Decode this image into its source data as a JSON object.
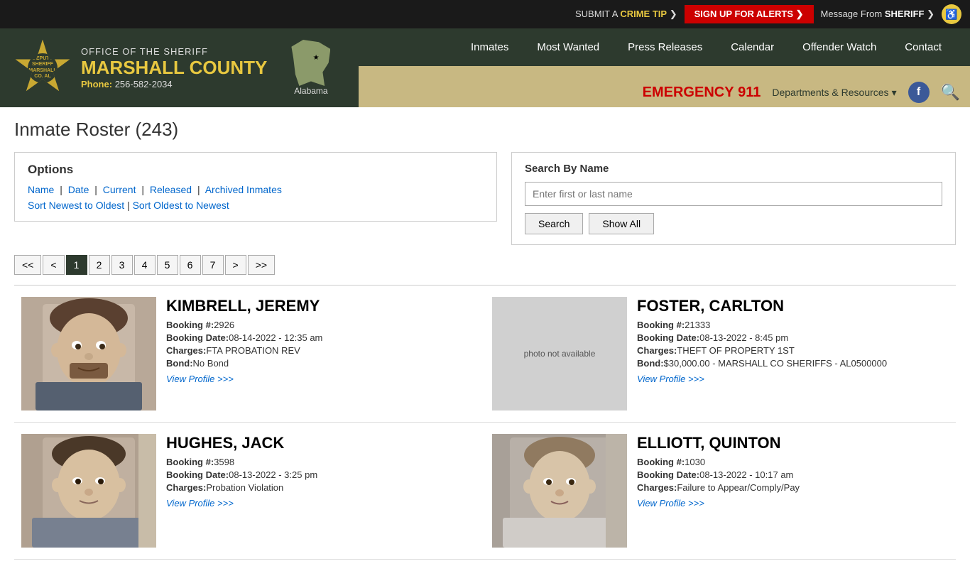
{
  "topbar": {
    "crime_tip": "SUBMIT A",
    "crime_tip_strong": "CRIME TIP",
    "crime_tip_arrow": "❯",
    "alerts_btn": "SIGN UP FOR ALERTS ❯",
    "message": "Message From",
    "message_strong": "SHERIFF",
    "message_arrow": "❯",
    "accessibility": "♿"
  },
  "header": {
    "office_title": "OFFICE OF THE SHERIFF",
    "county": "MARSHALL COUNTY",
    "phone_label": "Phone:",
    "phone": "256-582-2034",
    "map_label": "Alabama",
    "badge_text": "DEPUTY SHERIFF MARSHALL CO. AL"
  },
  "nav": {
    "main_items": [
      "Inmates",
      "Most Wanted",
      "Press Releases",
      "Calendar",
      "Offender Watch",
      "Contact"
    ],
    "emergency_label": "EMERGENCY",
    "emergency_number": "911",
    "dept_resources": "Departments & Resources",
    "dept_chevron": "▾"
  },
  "page": {
    "title": "Inmate Roster (243)"
  },
  "options": {
    "heading": "Options",
    "links": [
      "Name",
      "Date",
      "Current",
      "Released",
      "Archived Inmates"
    ],
    "sort_newest": "Sort Newest to Oldest",
    "sort_oldest": "Sort Oldest to Newest"
  },
  "search": {
    "title": "Search By Name",
    "placeholder": "Enter first or last name",
    "search_btn": "Search",
    "show_all_btn": "Show All"
  },
  "pagination": {
    "first": "<<",
    "prev": "<",
    "pages": [
      "1",
      "2",
      "3",
      "4",
      "5",
      "6",
      "7"
    ],
    "active_page": "1",
    "next": ">",
    "last": ">>"
  },
  "inmates": [
    {
      "name": "KIMBRELL, JEREMY",
      "booking_num": "2926",
      "booking_date": "08-14-2022 - 12:35 am",
      "charges": "FTA PROBATION REV",
      "bond": "No Bond",
      "view_profile": "View Profile >>>",
      "has_photo": true
    },
    {
      "name": "FOSTER, CARLTON",
      "booking_num": "21333",
      "booking_date": "08-13-2022 - 8:45 pm",
      "charges": "THEFT OF PROPERTY 1ST",
      "bond": "$30,000.00 - MARSHALL CO SHERIFFS - AL0500000",
      "view_profile": "View Profile >>>",
      "has_photo": false
    },
    {
      "name": "HUGHES, JACK",
      "booking_num": "3598",
      "booking_date": "08-13-2022 - 3:25 pm",
      "charges": "Probation Violation",
      "bond": "",
      "view_profile": "View Profile >>>",
      "has_photo": true
    },
    {
      "name": "ELLIOTT, QUINTON",
      "booking_num": "1030",
      "booking_date": "08-13-2022 - 10:17 am",
      "charges": "Failure to Appear/Comply/Pay",
      "bond": "",
      "view_profile": "View Profile >>>",
      "has_photo": true
    }
  ],
  "labels": {
    "booking_num": "Booking #:",
    "booking_date": "Booking Date:",
    "charges": "Charges:",
    "bond": "Bond:",
    "photo_na": "photo not available"
  }
}
